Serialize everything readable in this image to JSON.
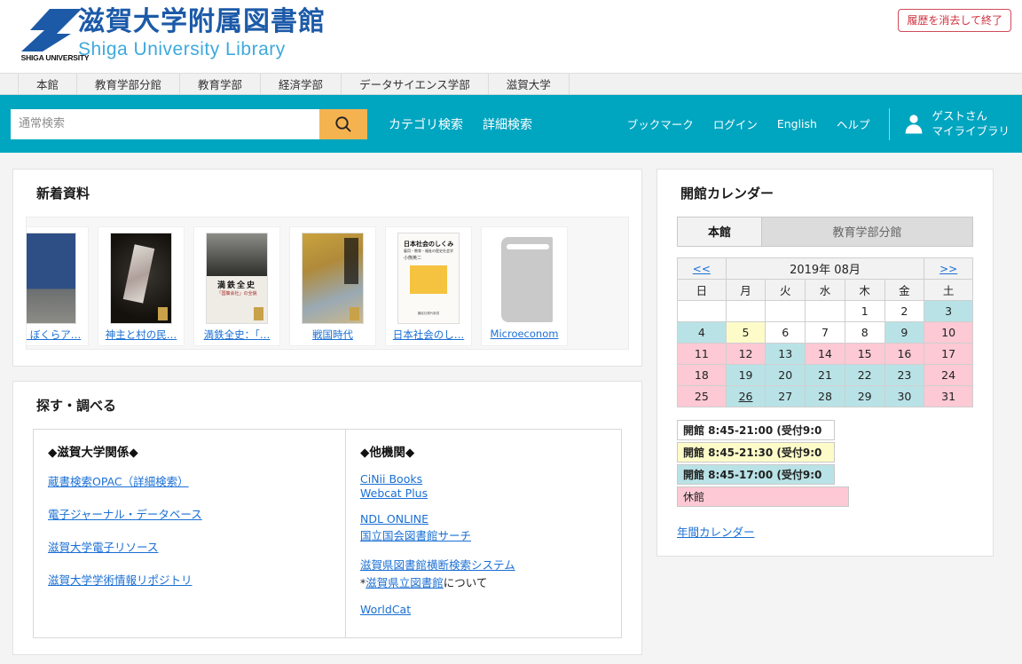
{
  "header": {
    "logo_caption": "SHIGA UNIVERSITY",
    "title_jp": "滋賀大学附属図書館",
    "title_en": "Shiga University Library",
    "exit_button": "履歴を消去して終了",
    "brand_blue": "#1c5aa8",
    "brand_lightblue": "#3fa9dc",
    "accent_teal": "#00a5c0",
    "accent_orange": "#f5b350"
  },
  "nav": {
    "items": [
      {
        "label": "本館"
      },
      {
        "label": "教育学部分館"
      },
      {
        "label": "教育学部"
      },
      {
        "label": "経済学部"
      },
      {
        "label": "データサイエンス学部"
      },
      {
        "label": "滋賀大学"
      }
    ]
  },
  "search": {
    "placeholder": "通常検索",
    "value": "",
    "icon": "search-icon",
    "links": [
      {
        "label": "カテゴリ検索"
      },
      {
        "label": "詳細検索"
      }
    ]
  },
  "account": {
    "links": [
      {
        "label": "ブックマーク"
      },
      {
        "label": "ログイン"
      },
      {
        "label": "English"
      },
      {
        "label": "ヘルプ"
      }
    ],
    "icon": "user-icon",
    "name": "ゲストさん",
    "mylibrary": "マイライブラリ"
  },
  "new_arrivals": {
    "title": "新着資料",
    "books": [
      {
        "label": "今・ぼくらア…",
        "cover": "blue-cover",
        "clipped": true
      },
      {
        "label": "神主と村の民…",
        "cover": "dark-cover"
      },
      {
        "label": "満鉄全史：「…",
        "cover": "mantetsu-cover"
      },
      {
        "label": "戦国時代",
        "cover": "sengoku-cover"
      },
      {
        "label": "日本社会のし…",
        "cover": "nihon-cover"
      },
      {
        "label": "Microeconom",
        "cover": "placeholder-cover",
        "clipped": true
      }
    ]
  },
  "explore": {
    "title": "探す・調べる",
    "left": {
      "heading": "◆滋賀大学関係◆",
      "links": [
        {
          "label": "蔵書検索OPAC（詳細検索）"
        },
        {
          "label": "電子ジャーナル・データベース"
        },
        {
          "label": "滋賀大学電子リソース"
        },
        {
          "label": "滋賀大学学術情報リポジトリ"
        }
      ]
    },
    "right": {
      "heading": "◆他機関◆",
      "groups": [
        {
          "links": [
            {
              "label": "CiNii Books"
            },
            {
              "label": "Webcat Plus"
            }
          ]
        },
        {
          "links": [
            {
              "label": "NDL ONLINE"
            },
            {
              "label": "国立国会図書館サーチ"
            }
          ]
        },
        {
          "links": [
            {
              "label": "滋賀県図書館横断検索システム"
            }
          ],
          "note_prefix": "*",
          "note_link": "滋賀県立図書館",
          "note_suffix": "について"
        },
        {
          "links": [
            {
              "label": "WorldCat"
            }
          ]
        }
      ]
    }
  },
  "calendar": {
    "title": "開館カレンダー",
    "tabs": [
      {
        "label": "本館",
        "active": true
      },
      {
        "label": "教育学部分館",
        "active": false
      }
    ],
    "prev": "<<",
    "next": ">>",
    "month_label": "2019年 08月",
    "dow": [
      "日",
      "月",
      "火",
      "水",
      "木",
      "金",
      "土"
    ],
    "weeks": [
      [
        {
          "d": "",
          "t": "empty"
        },
        {
          "d": "",
          "t": "empty"
        },
        {
          "d": "",
          "t": "empty"
        },
        {
          "d": "",
          "t": "empty"
        },
        {
          "d": "1",
          "t": "open"
        },
        {
          "d": "2",
          "t": "open"
        },
        {
          "d": "3",
          "t": "teal"
        }
      ],
      [
        {
          "d": "4",
          "t": "teal"
        },
        {
          "d": "5",
          "t": "yellow"
        },
        {
          "d": "6",
          "t": "open"
        },
        {
          "d": "7",
          "t": "open"
        },
        {
          "d": "8",
          "t": "open"
        },
        {
          "d": "9",
          "t": "teal"
        },
        {
          "d": "10",
          "t": "pink"
        }
      ],
      [
        {
          "d": "11",
          "t": "pink"
        },
        {
          "d": "12",
          "t": "pink"
        },
        {
          "d": "13",
          "t": "teal"
        },
        {
          "d": "14",
          "t": "pink"
        },
        {
          "d": "15",
          "t": "pink"
        },
        {
          "d": "16",
          "t": "pink"
        },
        {
          "d": "17",
          "t": "pink"
        }
      ],
      [
        {
          "d": "18",
          "t": "pink"
        },
        {
          "d": "19",
          "t": "teal"
        },
        {
          "d": "20",
          "t": "teal"
        },
        {
          "d": "21",
          "t": "teal"
        },
        {
          "d": "22",
          "t": "teal"
        },
        {
          "d": "23",
          "t": "teal"
        },
        {
          "d": "24",
          "t": "pink"
        }
      ],
      [
        {
          "d": "25",
          "t": "pink"
        },
        {
          "d": "26",
          "t": "teal",
          "today": true
        },
        {
          "d": "27",
          "t": "teal"
        },
        {
          "d": "28",
          "t": "teal"
        },
        {
          "d": "29",
          "t": "teal"
        },
        {
          "d": "30",
          "t": "teal"
        },
        {
          "d": "31",
          "t": "pink"
        }
      ]
    ],
    "legend": [
      {
        "label": "開館 8:45-21:00 (受付9:0",
        "type": "open"
      },
      {
        "label": "開館 8:45-21:30 (受付9:0",
        "type": "yellow"
      },
      {
        "label": "開館 8:45-17:00 (受付9:0",
        "type": "teal"
      },
      {
        "label": "休館",
        "type": "pink"
      }
    ],
    "year_link": "年間カレンダー"
  }
}
